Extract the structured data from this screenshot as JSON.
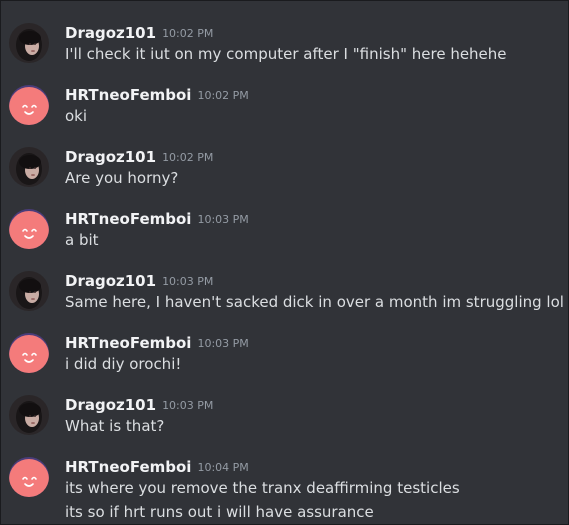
{
  "messages": [
    {
      "author": "Dragoz101",
      "time": "10:02 PM",
      "lines": [
        "I'll check it iut on my computer after I \"finish\" here hehehe"
      ]
    },
    {
      "author": "HRTneoFemboi",
      "time": "10:02 PM",
      "lines": [
        "oki"
      ]
    },
    {
      "author": "Dragoz101",
      "time": "10:02 PM",
      "lines": [
        "Are you horny?"
      ]
    },
    {
      "author": "HRTneoFemboi",
      "time": "10:03 PM",
      "lines": [
        "a bit"
      ]
    },
    {
      "author": "Dragoz101",
      "time": "10:03 PM",
      "lines": [
        "Same here, I haven't sacked dick in over a month im struggling lol"
      ]
    },
    {
      "author": "HRTneoFemboi",
      "time": "10:03 PM",
      "lines": [
        "i did diy orochi!"
      ]
    },
    {
      "author": "Dragoz101",
      "time": "10:03 PM",
      "lines": [
        "What is that?"
      ]
    },
    {
      "author": "HRTneoFemboi",
      "time": "10:04 PM",
      "lines": [
        "its where you remove the tranx deaffirming testicles",
        "its so if hrt runs out i will have assurance"
      ]
    }
  ],
  "avatars": {
    "Dragoz101": "photo-avatar",
    "HRTneoFemboi": "pink-face-avatar"
  },
  "colors": {
    "background": "#313338",
    "username": "#f2f3f5",
    "timestamp": "#949ba4",
    "message_text": "#dbdee1",
    "pink_avatar": "#f47b7b"
  }
}
